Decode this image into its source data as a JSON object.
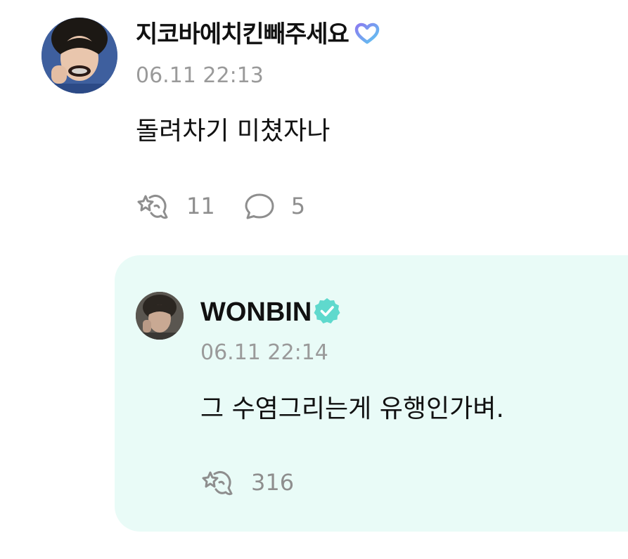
{
  "post": {
    "author": "지코바에치킨빼주세요",
    "badge_icon": "heart-membership-icon",
    "timestamp": "06.11 22:13",
    "text": "돌려차기 미쳤자나",
    "like_count": "11",
    "comment_count": "5",
    "like_icon": "cheer-hand-icon",
    "comment_icon": "speech-bubble-icon"
  },
  "reply": {
    "author": "WONBIN",
    "badge_icon": "verified-check-icon",
    "timestamp": "06.11 22:14",
    "text": "그 수염그리는게 유행인가벼.",
    "like_count": "316",
    "like_icon": "cheer-hand-icon"
  },
  "colors": {
    "reply_background": "#e9fbf7",
    "verified": "#5fd9cd",
    "muted_text": "#9a9a9a",
    "heart_gradient_start": "#7c8cf0",
    "heart_gradient_end": "#5fc6f0"
  }
}
